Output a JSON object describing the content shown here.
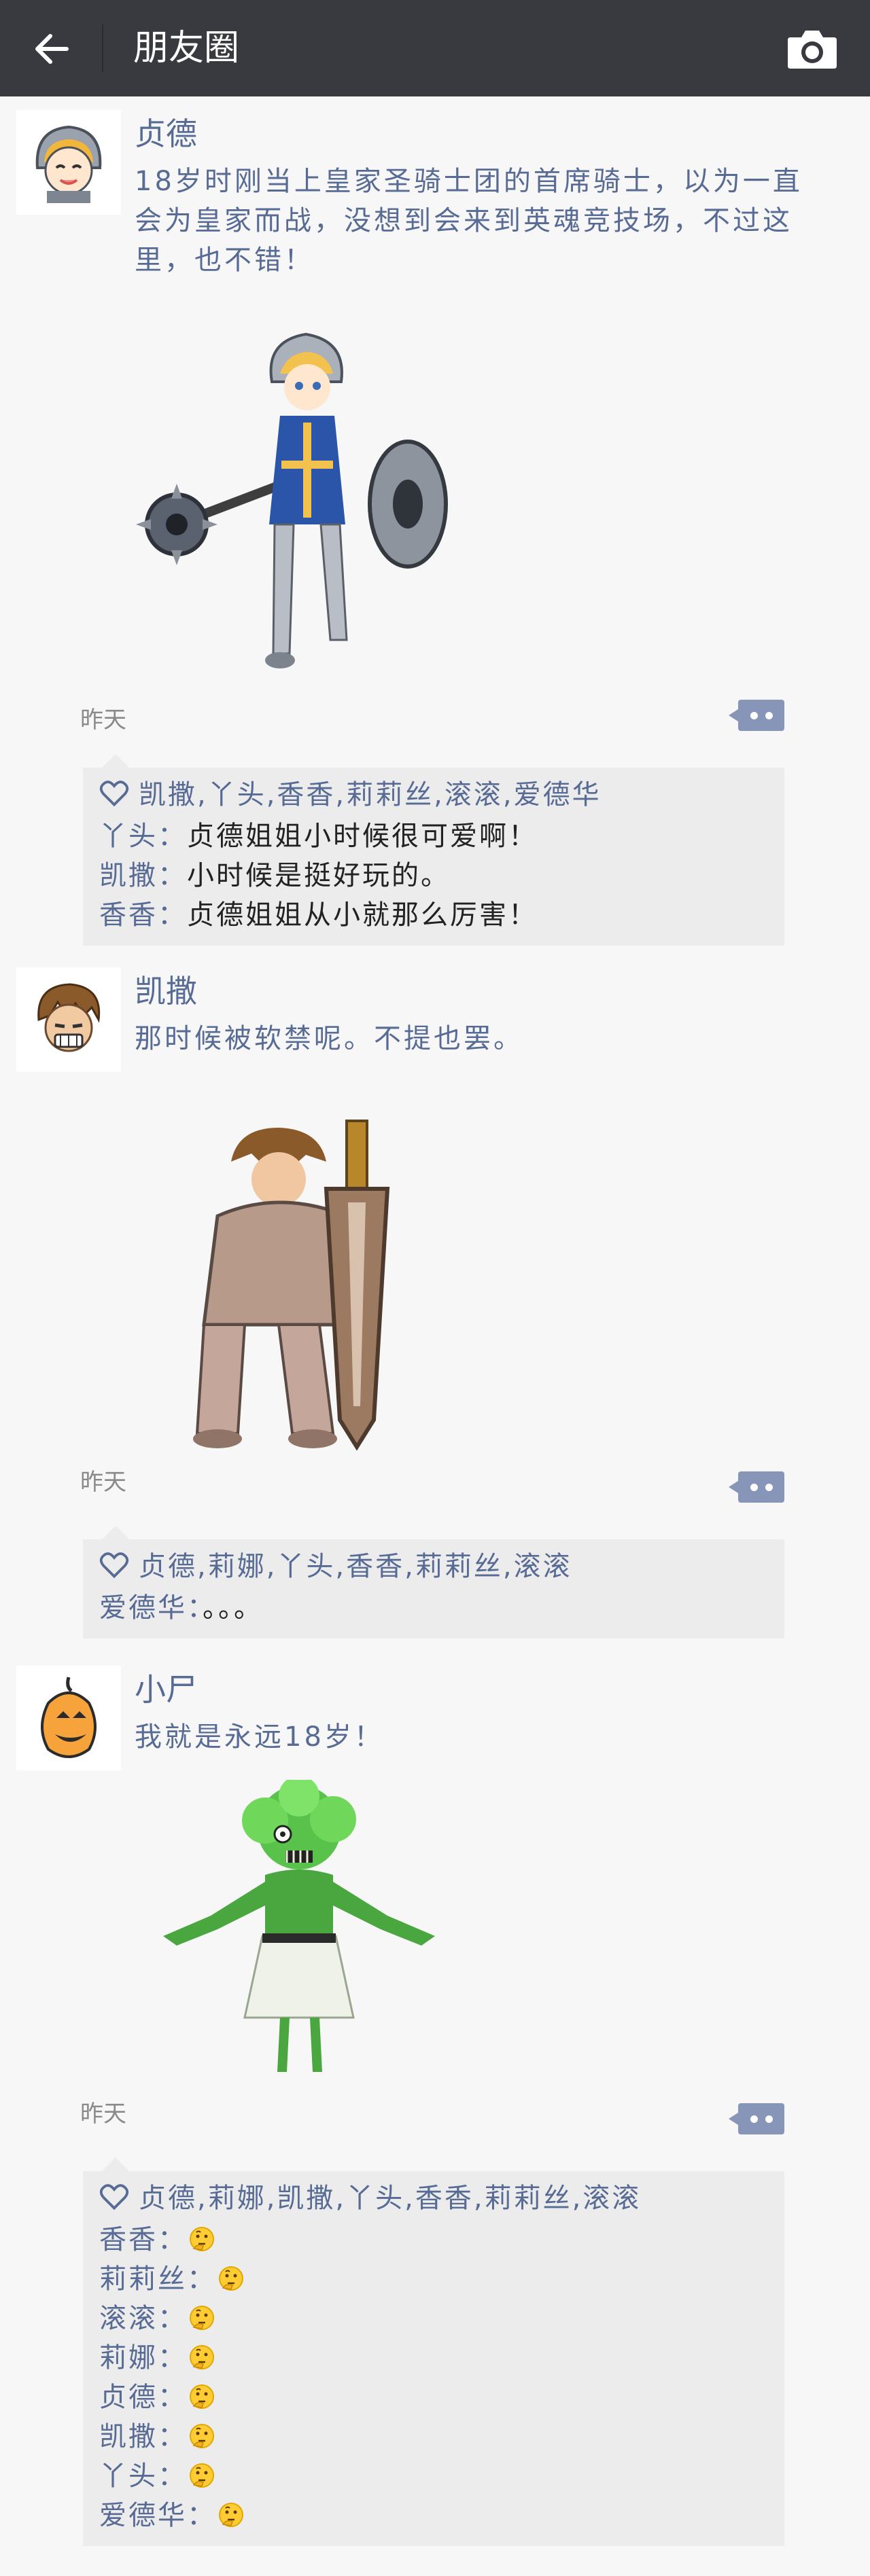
{
  "header": {
    "title": "朋友圈"
  },
  "posts": [
    {
      "author": "贞德",
      "content": "18岁时刚当上皇家圣骑士团的首席骑士，以为一直会为皇家而战，没想到会来到英魂竞技场，不过这里，也不错！",
      "time": "昨天",
      "likes": "凯撒,丫头,香香,莉莉丝,滚滚,爱德华",
      "comments": [
        {
          "name": "丫头",
          "sep": "：",
          "text": "贞德姐姐小时候很可爱啊！"
        },
        {
          "name": "凯撒",
          "sep": "：",
          "text": "小时候是挺好玩的。"
        },
        {
          "name": "香香",
          "sep": "：",
          "text": "贞德姐姐从小就那么厉害！"
        }
      ]
    },
    {
      "author": "凯撒",
      "content": "那时候被软禁呢。不提也罢。",
      "time": "昨天",
      "likes": "贞德,莉娜,丫头,香香,莉莉丝,滚滚",
      "comments": [
        {
          "name": "爱德华",
          "sep": "：",
          "text": "。。。"
        }
      ]
    },
    {
      "author": "小尸",
      "content": "我就是永远18岁！",
      "time": "昨天",
      "likes": "贞德,莉娜,凯撒,丫头,香香,莉莉丝,滚滚",
      "comments": [
        {
          "name": "香香",
          "sep": "："
        },
        {
          "name": "莉莉丝",
          "sep": "："
        },
        {
          "name": "滚滚",
          "sep": "："
        },
        {
          "name": "莉娜",
          "sep": "："
        },
        {
          "name": "贞德",
          "sep": "："
        },
        {
          "name": "凯撒",
          "sep": "："
        },
        {
          "name": "丫头",
          "sep": "："
        },
        {
          "name": "爱德华",
          "sep": "："
        }
      ]
    }
  ],
  "colors": {
    "header_bg": "#393a3f",
    "page_bg": "#f7f7f7",
    "link_blue": "#576b95",
    "comment_panel": "#ececec"
  },
  "icons": {
    "back": "back-arrow-icon",
    "camera": "camera-icon",
    "comment": "comment-dots-icon",
    "heart": "heart-outline-icon",
    "emoji": "thinking-face-icon"
  }
}
